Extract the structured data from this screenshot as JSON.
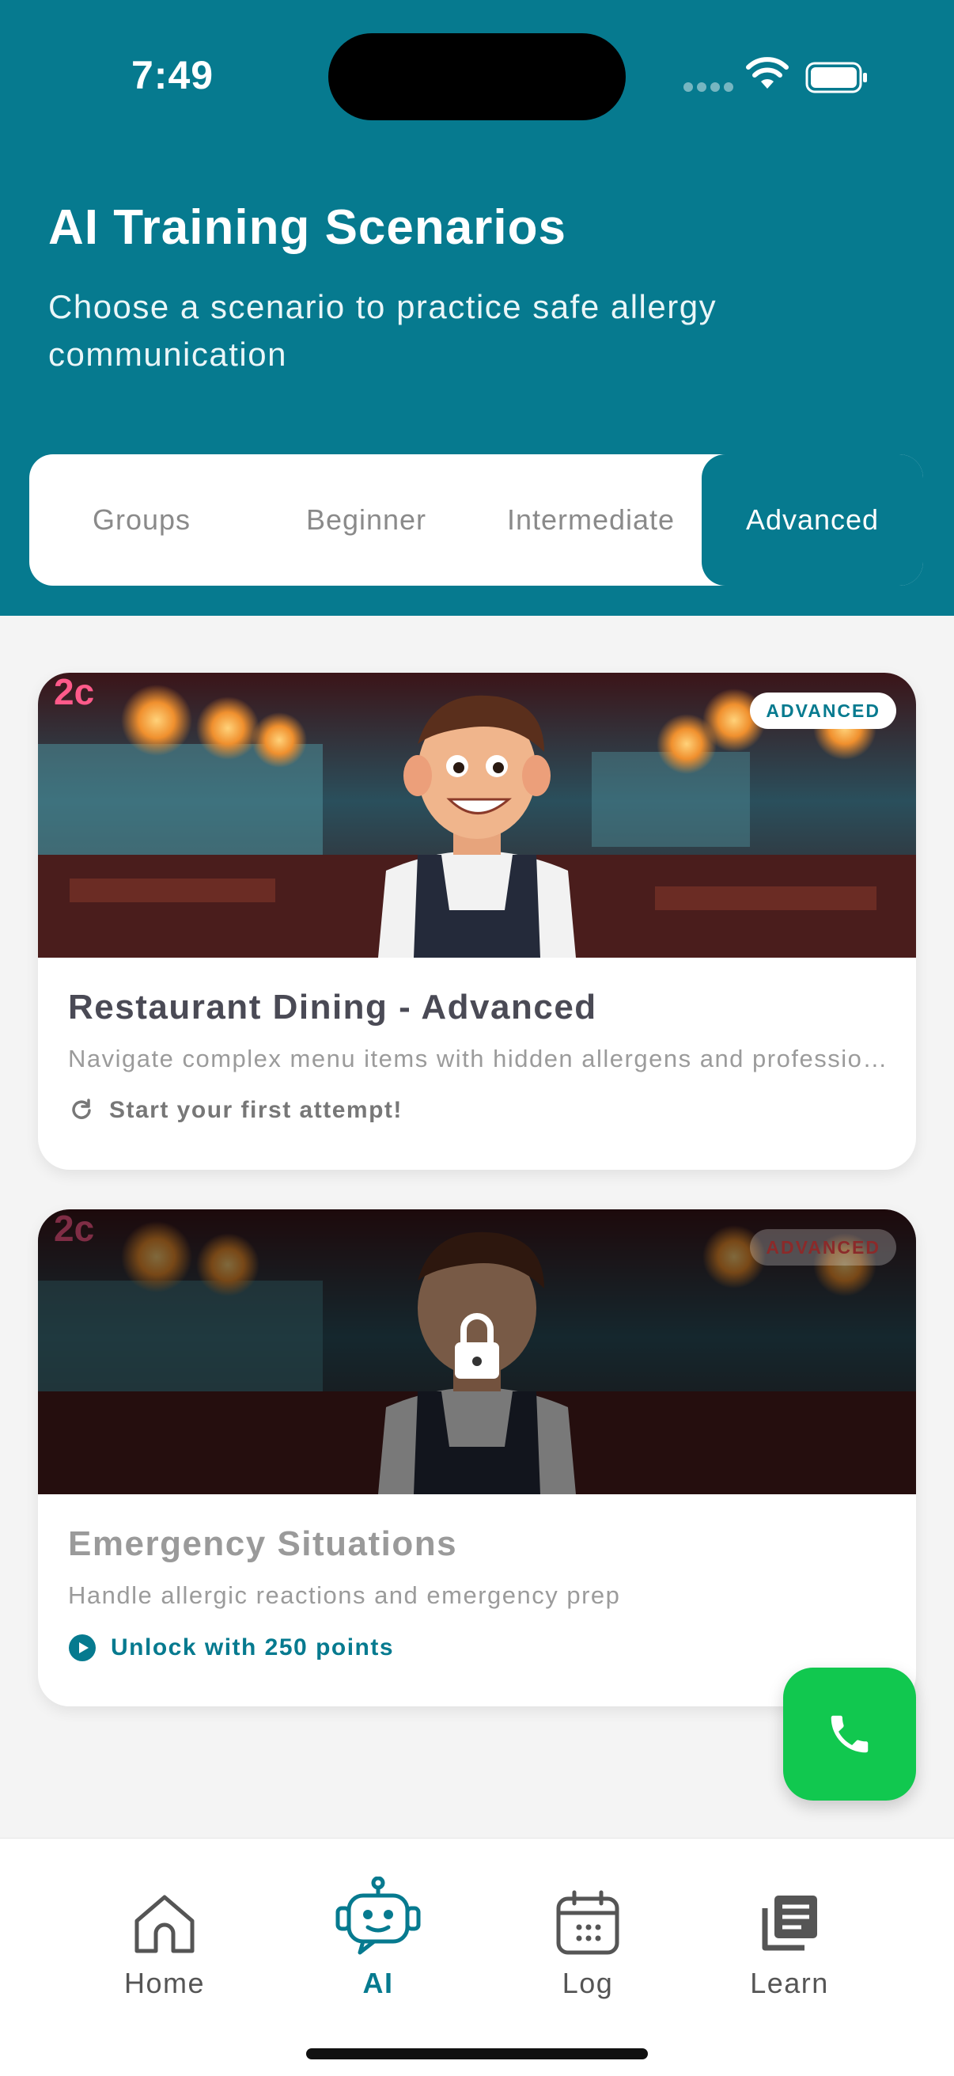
{
  "status_bar": {
    "time": "7:49"
  },
  "header": {
    "title": "AI Training Scenarios",
    "subtitle": "Choose a scenario to practice safe allergy communication"
  },
  "tabs": [
    {
      "label": "Groups",
      "active": false
    },
    {
      "label": "Beginner",
      "active": false
    },
    {
      "label": "Intermediate",
      "active": false
    },
    {
      "label": "Advanced",
      "active": true
    }
  ],
  "scenarios": [
    {
      "badge": "ADVANCED",
      "title": "Restaurant Dining - Advanced",
      "description": "Navigate complex menu items with hidden allergens and professional staff",
      "status": "Start your first attempt!",
      "locked": false
    },
    {
      "badge": "ADVANCED",
      "title": "Emergency Situations",
      "description": "Handle allergic reactions and emergency prep",
      "status": "Unlock with 250 points",
      "locked": true
    }
  ],
  "fab": {
    "icon": "phone-icon"
  },
  "bottom_nav": [
    {
      "label": "Home",
      "icon": "home-icon",
      "active": false
    },
    {
      "label": "AI",
      "icon": "robot-icon",
      "active": true
    },
    {
      "label": "Log",
      "icon": "calendar-icon",
      "active": false
    },
    {
      "label": "Learn",
      "icon": "library-icon",
      "active": false
    }
  ],
  "colors": {
    "primary": "#067a8f",
    "fab": "#11c84f",
    "badge_locked": "#8b2a2a"
  }
}
